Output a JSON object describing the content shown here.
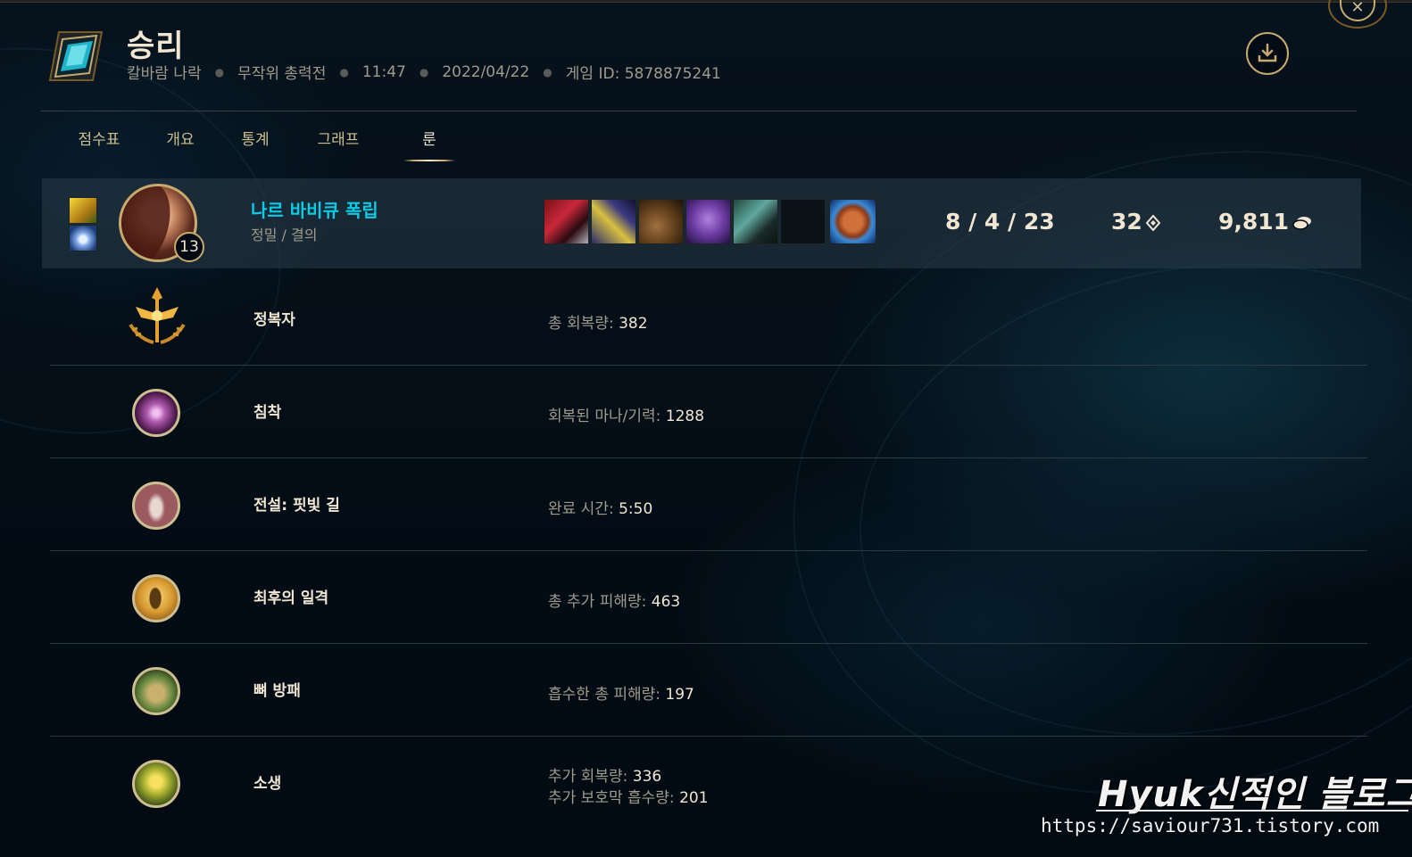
{
  "header": {
    "title": "승리",
    "map": "칼바람 나락",
    "mode": "무작위 총력전",
    "duration": "11:47",
    "date": "2022/04/22",
    "game_id": "게임 ID: 5878875241"
  },
  "tabs": [
    {
      "label": "점수표"
    },
    {
      "label": "개요"
    },
    {
      "label": "통계"
    },
    {
      "label": "그래프"
    },
    {
      "label": "룬",
      "active": true
    }
  ],
  "player": {
    "name": "나르 바비큐 폭립",
    "sub": "정밀 / 결의",
    "level": "13",
    "kda": "8 / 4 / 23",
    "cs": "32",
    "gold": "9,811",
    "spells": [
      "flash-spell-icon",
      "mark-snowball-spell-icon"
    ],
    "items": [
      "item-1-icon",
      "item-2-icon",
      "item-3-icon",
      "item-4-icon",
      "item-5-icon",
      "empty-slot",
      "poro-snax-icon"
    ]
  },
  "runes": [
    {
      "name": "정복자",
      "stats": [
        {
          "label": "총 회복량: ",
          "value": "382"
        }
      ],
      "icon": "conqueror-icon"
    },
    {
      "name": "침착",
      "stats": [
        {
          "label": "회복된 마나/기력: ",
          "value": "1288"
        }
      ],
      "icon": "presence-of-mind-icon"
    },
    {
      "name": "전설: 핏빛 길",
      "stats": [
        {
          "label": "완료 시간: ",
          "value": "5:50"
        }
      ],
      "icon": "legend-bloodline-icon"
    },
    {
      "name": "최후의 일격",
      "stats": [
        {
          "label": "총 추가 피해량: ",
          "value": "463"
        }
      ],
      "icon": "coup-de-grace-icon"
    },
    {
      "name": "뼈 방패",
      "stats": [
        {
          "label": "흡수한 총 피해량: ",
          "value": "197"
        }
      ],
      "icon": "bone-plating-icon"
    },
    {
      "name": "소생",
      "stats": [
        {
          "label": "추가 회복량: ",
          "value": "336"
        },
        {
          "label": "추가 보호막 흡수량: ",
          "value": "201"
        }
      ],
      "icon": "revitalize-icon"
    }
  ],
  "watermark": {
    "title": "Hyuk신적인 블로그",
    "url": "https://saviour731.tistory.com"
  },
  "colors": {
    "gold": "#c8aa6e",
    "summoner_name": "#0acbe6",
    "text_light": "#f0e6d2",
    "text_muted": "#a09b8c"
  }
}
